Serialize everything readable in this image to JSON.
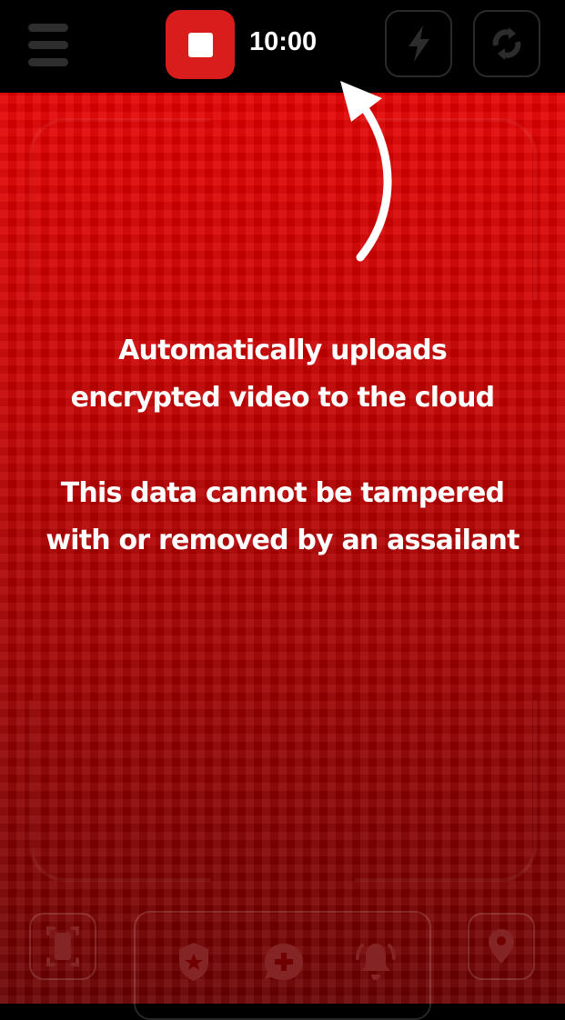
{
  "topbar": {
    "timer": "10:00",
    "icons": [
      "menu-icon",
      "stop-icon",
      "flash-icon",
      "switch-camera-icon"
    ]
  },
  "message": {
    "line1": "Automatically uploads",
    "line2": "encrypted video to the cloud",
    "line3": "This data cannot be tampered",
    "line4": "with or removed by an assailant"
  },
  "bottombar": {
    "icons": [
      "screen-capture-icon",
      "police-shield-icon",
      "medical-chat-icon",
      "alarm-bell-icon",
      "location-pin-icon"
    ]
  },
  "colors": {
    "accent": "#d91d1d",
    "background_top": "#e60000",
    "background_bottom": "#6a0000"
  }
}
